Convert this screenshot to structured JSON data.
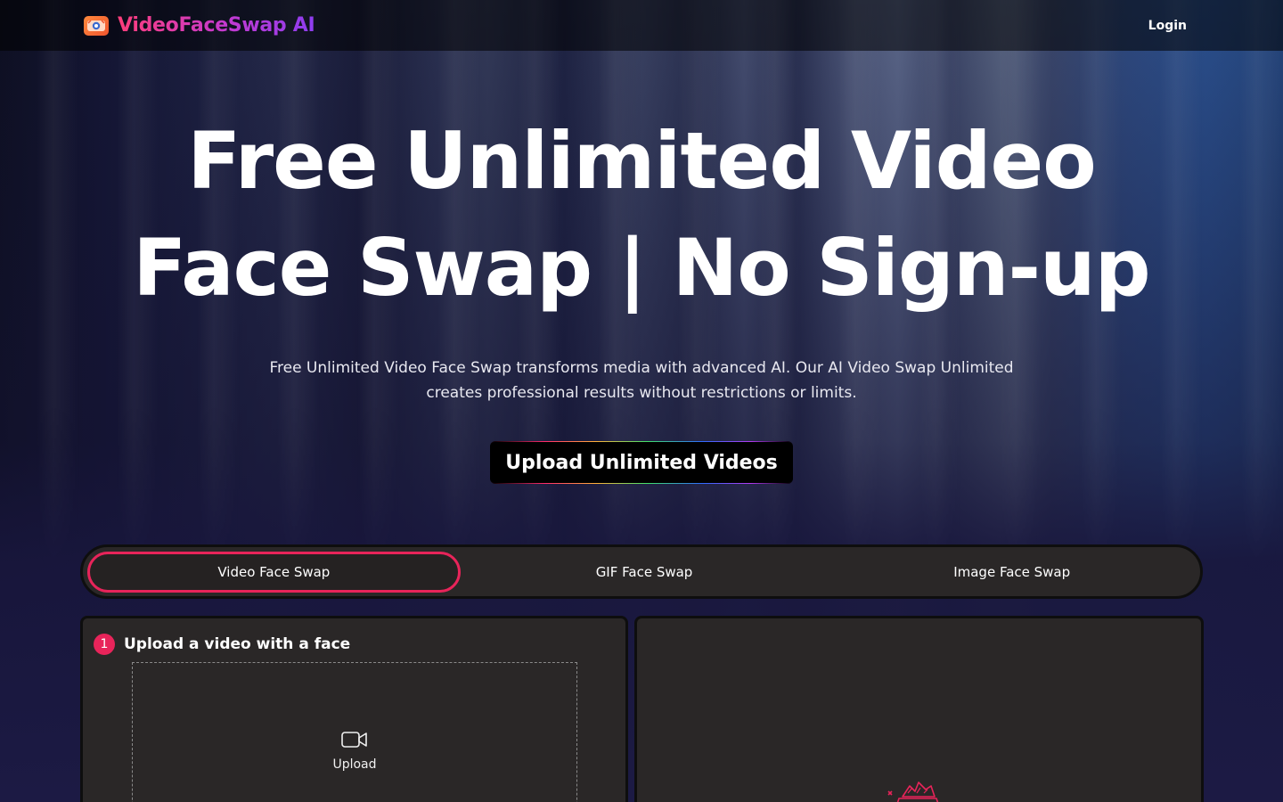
{
  "header": {
    "brand": "VideoFaceSwap AI",
    "logo_icon": "face-swap-logo-icon",
    "login_label": "Login"
  },
  "hero": {
    "title": "Free Unlimited Video Face Swap | No Sign-up",
    "subtitle": "Free Unlimited Video Face Swap transforms media with advanced AI. Our AI Video Swap Unlimited creates professional results without restrictions or limits.",
    "cta_label": "Upload Unlimited Videos"
  },
  "tabs": [
    {
      "label": "Video Face Swap",
      "active": true
    },
    {
      "label": "GIF Face Swap",
      "active": false
    },
    {
      "label": "Image Face Swap",
      "active": false
    }
  ],
  "upload_panel": {
    "step_number": "1",
    "step_title": "Upload a video with a face",
    "upload_icon": "video-camera-icon",
    "upload_label": "Upload"
  },
  "preview_panel": {
    "placeholder_icon": "preview-placeholder-icon"
  },
  "colors": {
    "accent": "#e8245a",
    "panel_bg": "#2a2727",
    "brand_gradient_start": "#ff3d7a",
    "brand_gradient_end": "#8e3df0"
  }
}
